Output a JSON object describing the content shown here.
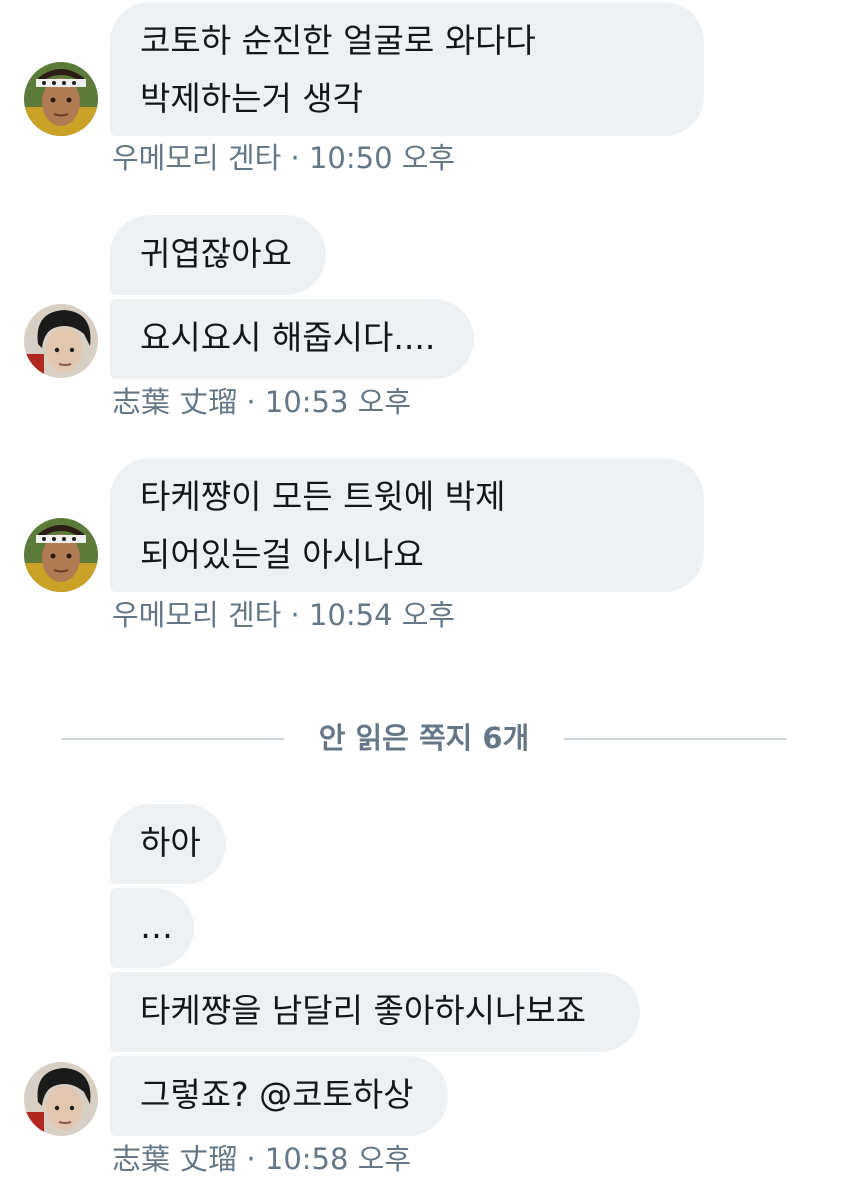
{
  "messages": [
    {
      "lines": [
        "코토하 순진한 얼굴로 와다다",
        "박제하는거 생각"
      ],
      "meta": "우메모리 겐타 · 10:50 오후"
    },
    {
      "bubbles": [
        "귀엽잖아요",
        "요시요시 해줍시다...."
      ],
      "meta": "志葉 丈瑠 · 10:53 오후"
    },
    {
      "lines": [
        "타케쨩이 모든 트윗에 박제",
        "되어있는걸 아시나요"
      ],
      "meta": "우메모리 겐타 · 10:54 오후"
    },
    {
      "bubbles": [
        "하아",
        "…",
        "타케쨩을 남달리 좋아하시나보죠",
        "그렇죠? @코토하상"
      ],
      "meta": "志葉 丈瑠 · 10:58 오후"
    }
  ],
  "divider": {
    "label": "안 읽은 쪽지 6개"
  },
  "colors": {
    "bubble_bg": "#eef1f4",
    "text": "#14171a",
    "meta": "#657786",
    "divider_line": "#ccd6dd"
  }
}
